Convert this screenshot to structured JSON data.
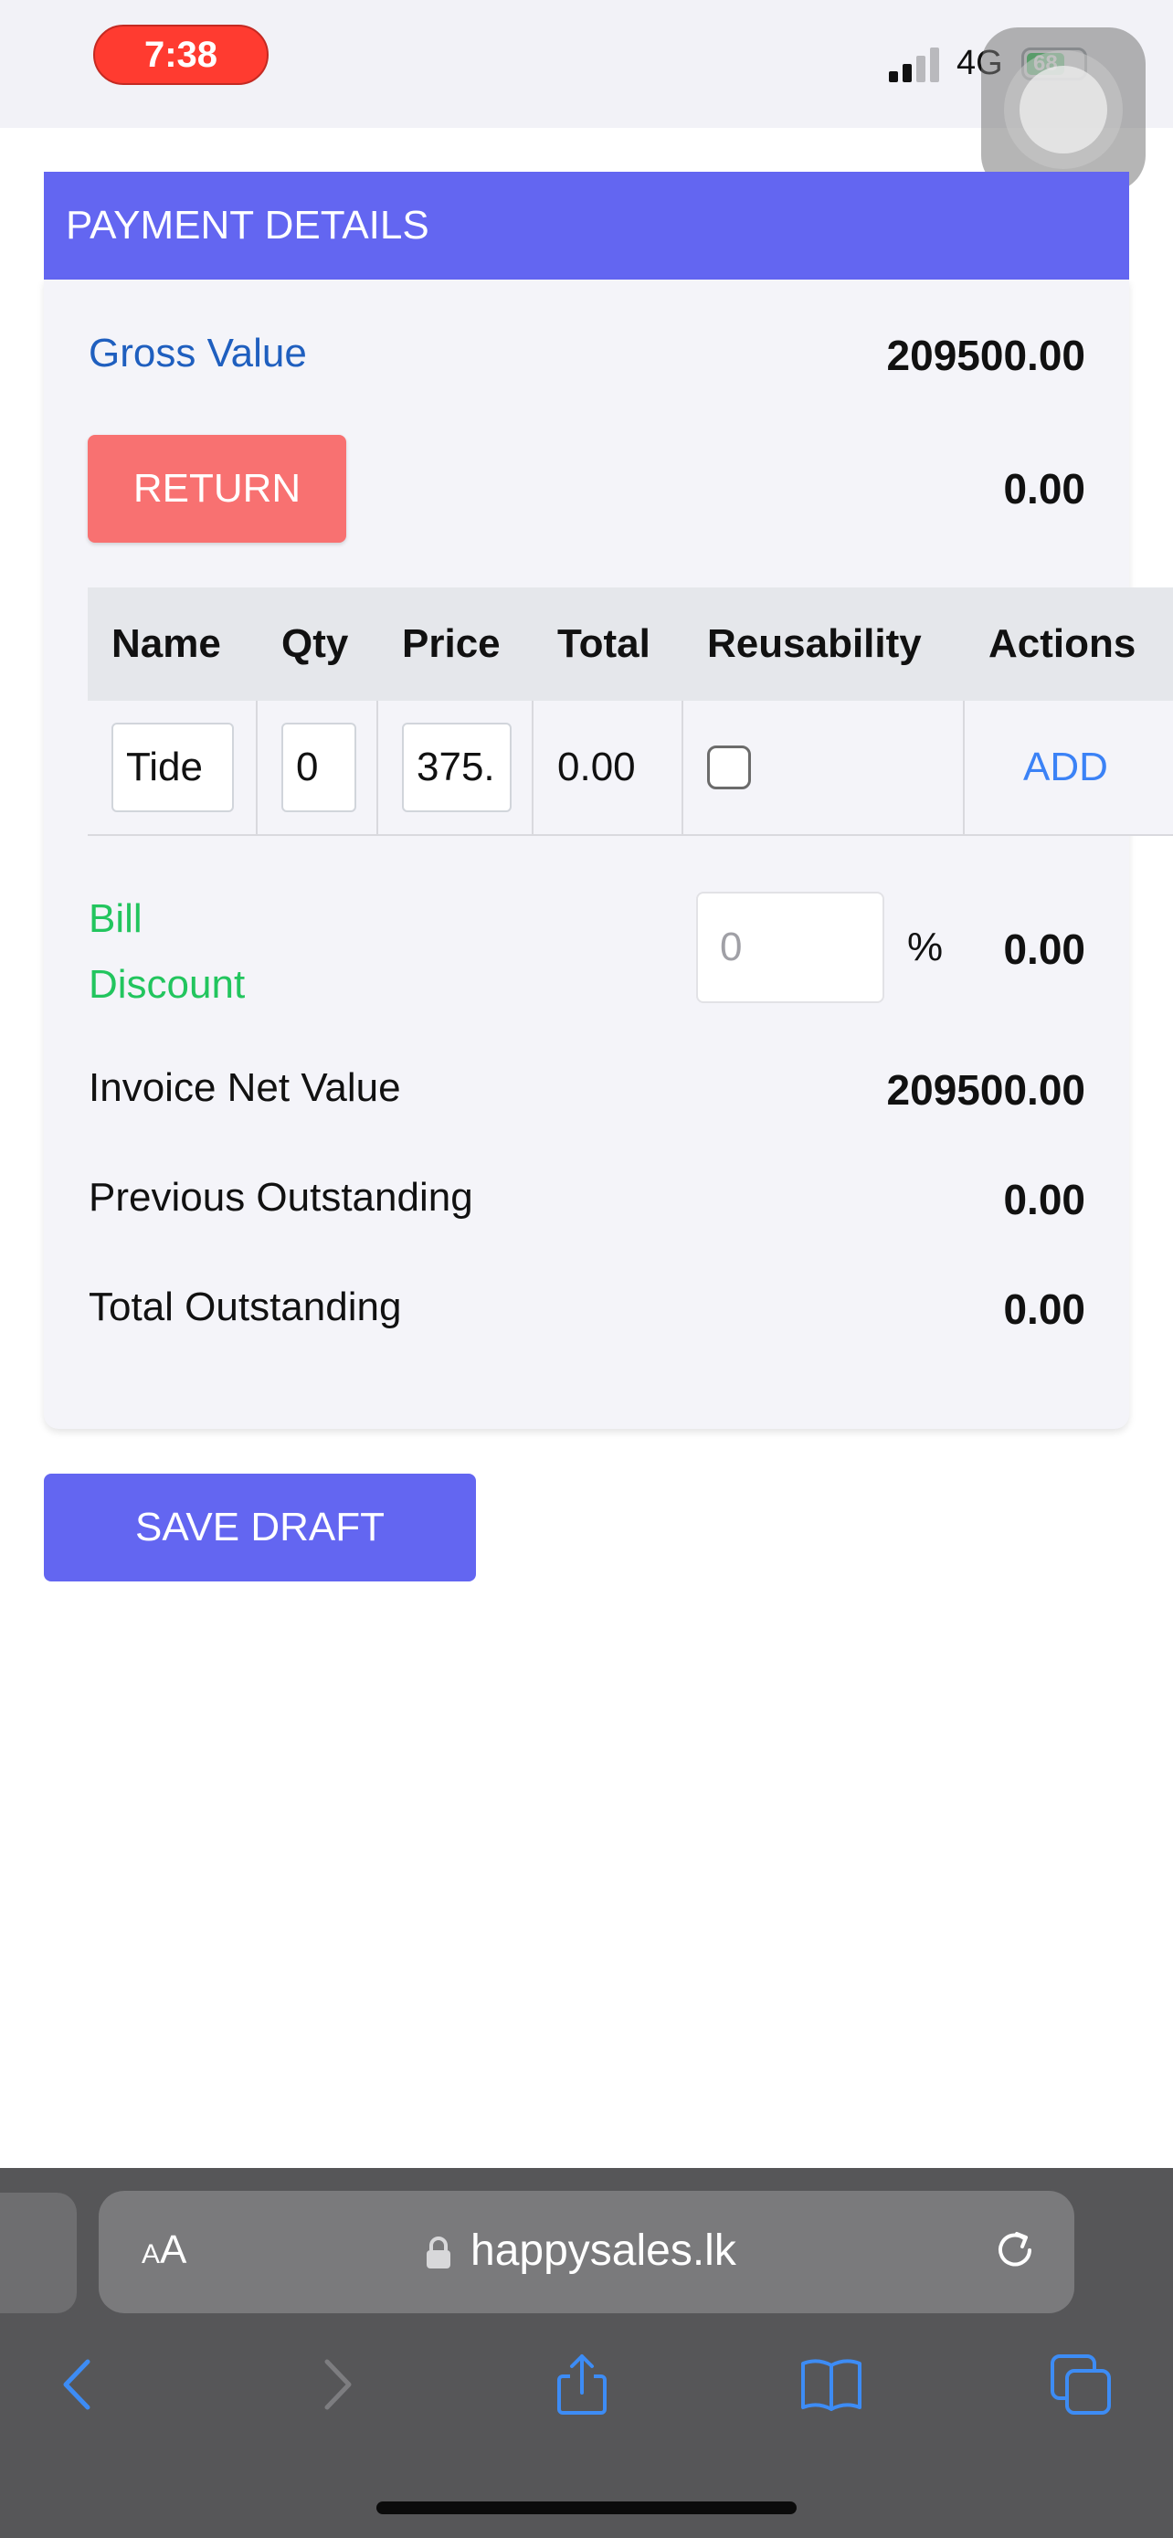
{
  "status_bar": {
    "time": "7:38",
    "network": "4G",
    "battery": "68"
  },
  "header": {
    "title": "PAYMENT DETAILS"
  },
  "payment": {
    "gross_label": "Gross Value",
    "gross_value": "209500.00",
    "return_label": "RETURN",
    "return_value": "0.00"
  },
  "table": {
    "headers": [
      "Name",
      "Qty",
      "Price",
      "Total",
      "Reusability",
      "Actions"
    ],
    "row": {
      "name": "Tide",
      "qty": "0",
      "price": "375.",
      "total": "0.00",
      "action": "ADD"
    }
  },
  "discount": {
    "label_line1": "Bill",
    "label_line2": "Discount",
    "placeholder": "0",
    "percent": "%",
    "value": "0.00"
  },
  "summary": {
    "invoice_net_label": "Invoice Net Value",
    "invoice_net_value": "209500.00",
    "prev_outstanding_label": "Previous Outstanding",
    "prev_outstanding_value": "0.00",
    "total_outstanding_label": "Total Outstanding",
    "total_outstanding_value": "0.00"
  },
  "save_label": "SAVE DRAFT",
  "browser": {
    "aa_small": "A",
    "aa_large": "A",
    "url": "happysales.lk"
  },
  "colors": {
    "accent": "#6366f1",
    "return": "#f87171",
    "discount_label": "#22c55e",
    "gross_label": "#1f5fbf"
  }
}
